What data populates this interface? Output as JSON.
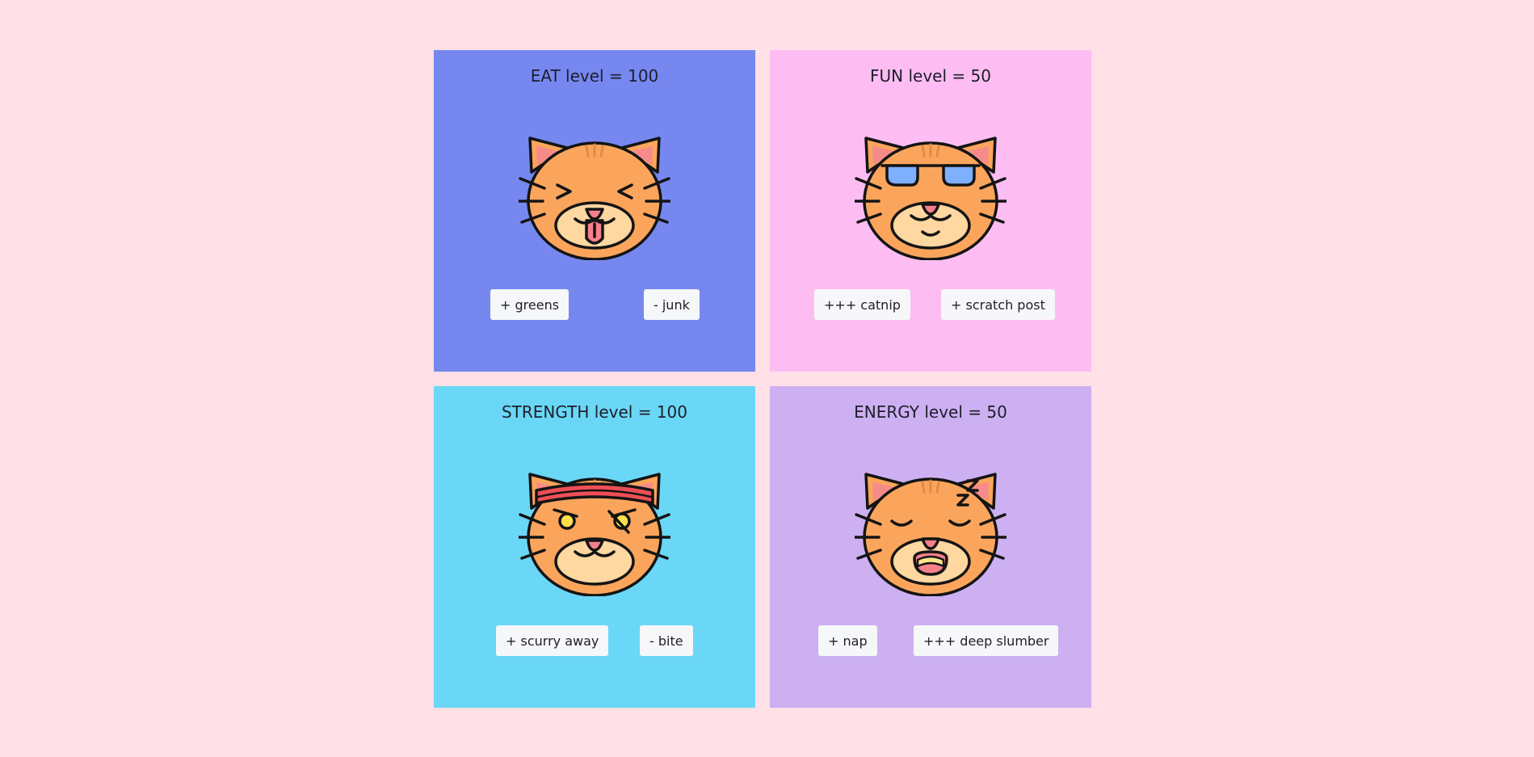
{
  "cards": [
    {
      "title": "EAT level = 100",
      "level": 100,
      "color": "#7688f0",
      "cat_icon": "cat-eating-icon",
      "buttons": [
        "+ greens",
        "- junk"
      ]
    },
    {
      "title": "FUN level = 50",
      "level": 50,
      "color": "#fdbdf2",
      "cat_icon": "cat-sunglasses-icon",
      "buttons": [
        "+++ catnip",
        "+ scratch post"
      ]
    },
    {
      "title": "STRENGTH level = 100",
      "level": 100,
      "color": "#6ad7f6",
      "cat_icon": "cat-headband-icon",
      "buttons": [
        "+ scurry away",
        "- bite"
      ]
    },
    {
      "title": "ENERGY level = 50",
      "level": 50,
      "color": "#cdb0f2",
      "cat_icon": "cat-sleeping-icon",
      "buttons": [
        "+ nap",
        "+++ deep slumber"
      ]
    }
  ],
  "colors": {
    "page_background": "#ffe0e6",
    "cat_fur": "#fba55c",
    "cat_muzzle": "#ffd7a0",
    "cat_ear_inner": "#f78a8a",
    "nose": "#f6808a",
    "sunglasses_lens": "#7fb0ff",
    "headband": "#ef4e56",
    "button_background": "#f6f7f9"
  }
}
